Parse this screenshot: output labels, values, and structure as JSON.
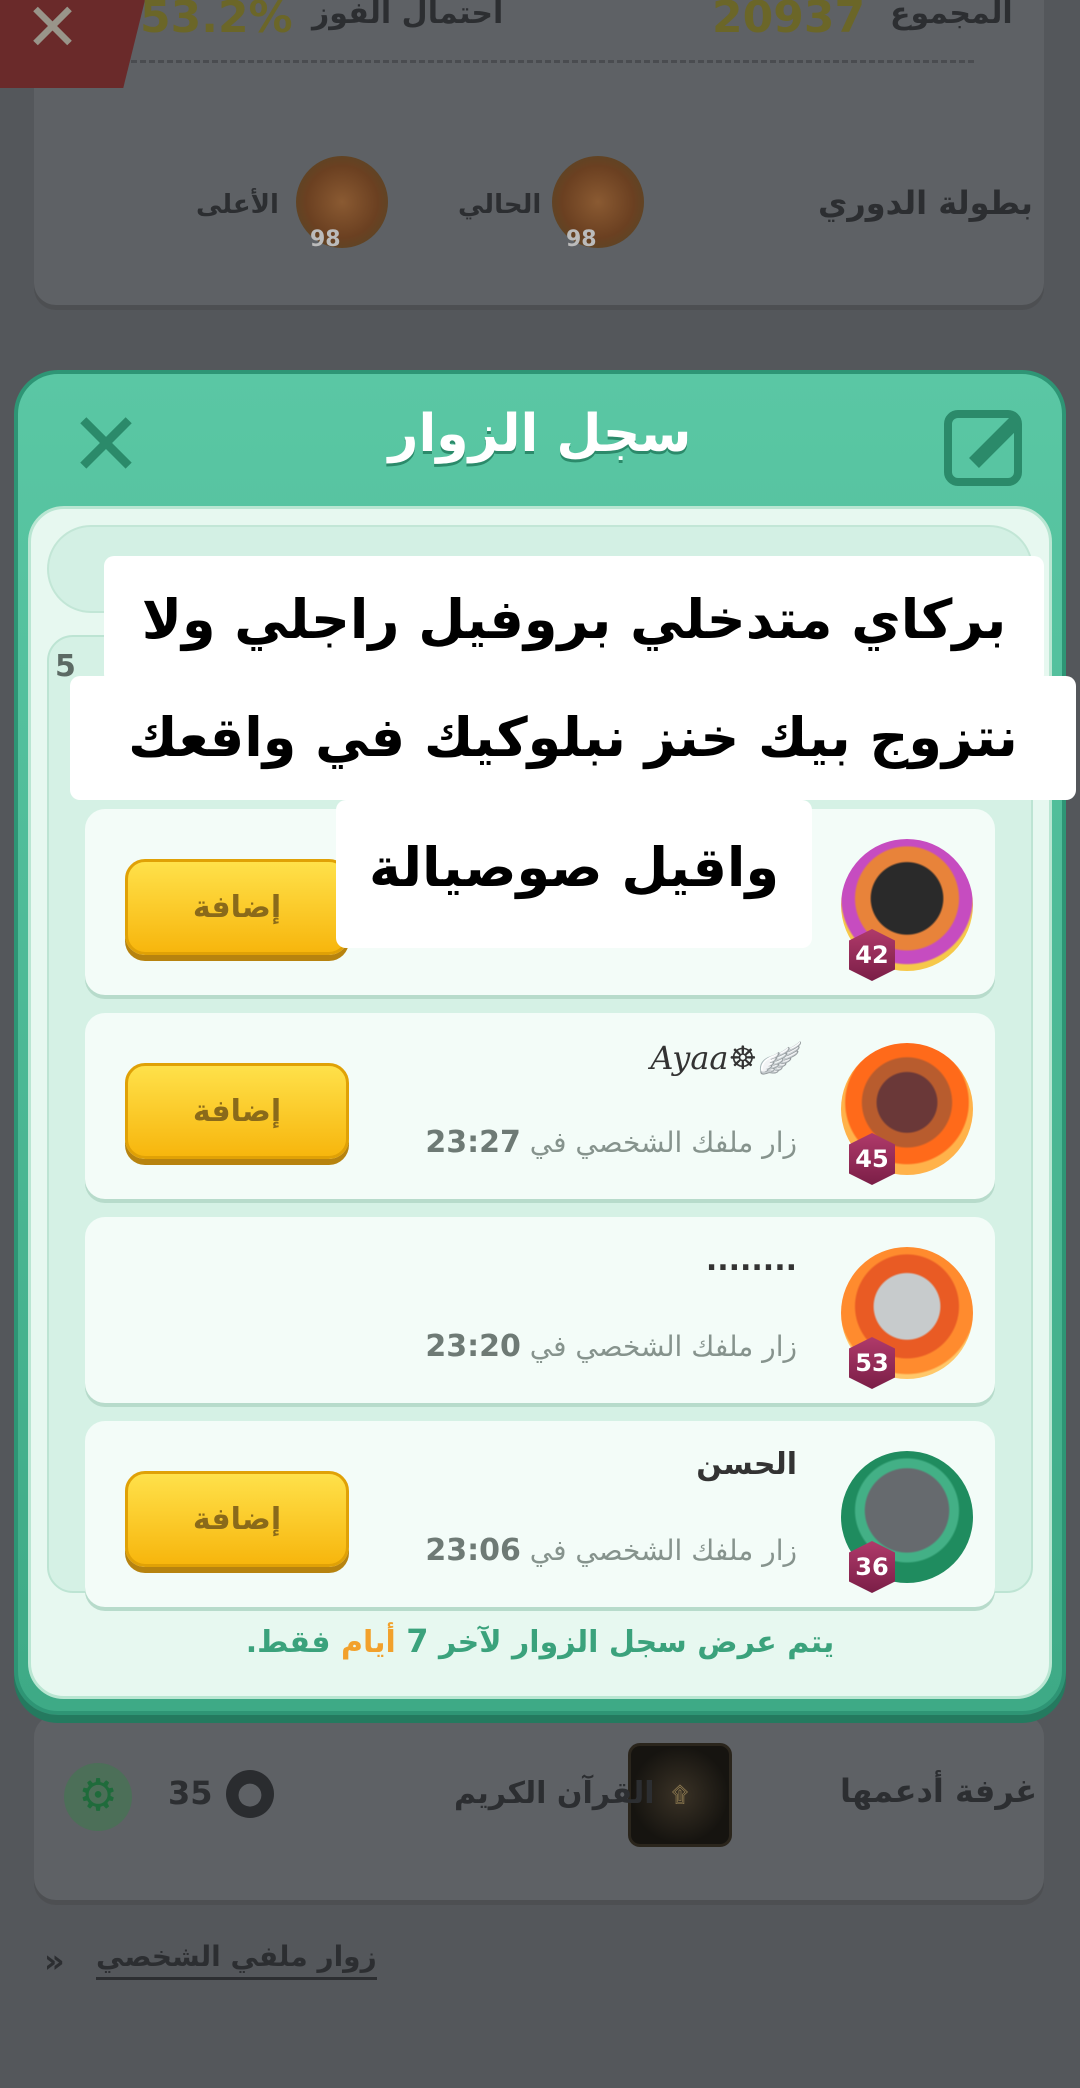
{
  "background": {
    "total_label": "المجموع",
    "total_value": "20937",
    "win_chance_label": "احتمال الفوز",
    "win_chance_value": "53.2%",
    "close_icon": "close-icon",
    "league_label": "بطولة الدوري",
    "current_label": "الحالي",
    "highest_label": "الأعلى",
    "badge_level_current": "98",
    "badge_level_highest": "98",
    "room_label": "غرفة أدعمها",
    "room_name": "القرآن الكريم",
    "room_members": "35",
    "visitors_link": "زوار ملفي الشخصي"
  },
  "modal": {
    "title": "سجل الزوار",
    "count_badge": "5",
    "visitors": [
      {
        "name": "",
        "visit_prefix": "",
        "time": "",
        "level": "42",
        "avatar": "joker",
        "add_label": "إضافة",
        "has_add": true
      },
      {
        "name": "Ayaa☸︎🪽",
        "visit_prefix": "زار ملفك الشخصي في",
        "time": "23:27",
        "level": "45",
        "avatar": "fire",
        "add_label": "إضافة",
        "has_add": true
      },
      {
        "name": "........",
        "visit_prefix": "زار ملفك الشخصي في",
        "time": "23:20",
        "level": "53",
        "avatar": "fire2",
        "add_label": "",
        "has_add": false
      },
      {
        "name": "الحسن",
        "visit_prefix": "زار ملفك الشخصي في",
        "time": "23:06",
        "level": "36",
        "avatar": "photo",
        "add_label": "إضافة",
        "has_add": true
      }
    ],
    "footer": {
      "prefix": "يتم عرض سجل الزوار لآخر",
      "number": "7",
      "days": "أيام",
      "suffix": "فقط."
    }
  },
  "caption": {
    "line1": "بركاي متدخلي بروفيل راجلي ولا",
    "line2": "نتزوج بيك خنز نبلوكيك في واقعك",
    "line3": "واقيل صوصيالة"
  },
  "colors": {
    "modal_green": "#3eaa86",
    "button_yellow": "#f7b60d",
    "footer_orange": "#f2a12c"
  }
}
